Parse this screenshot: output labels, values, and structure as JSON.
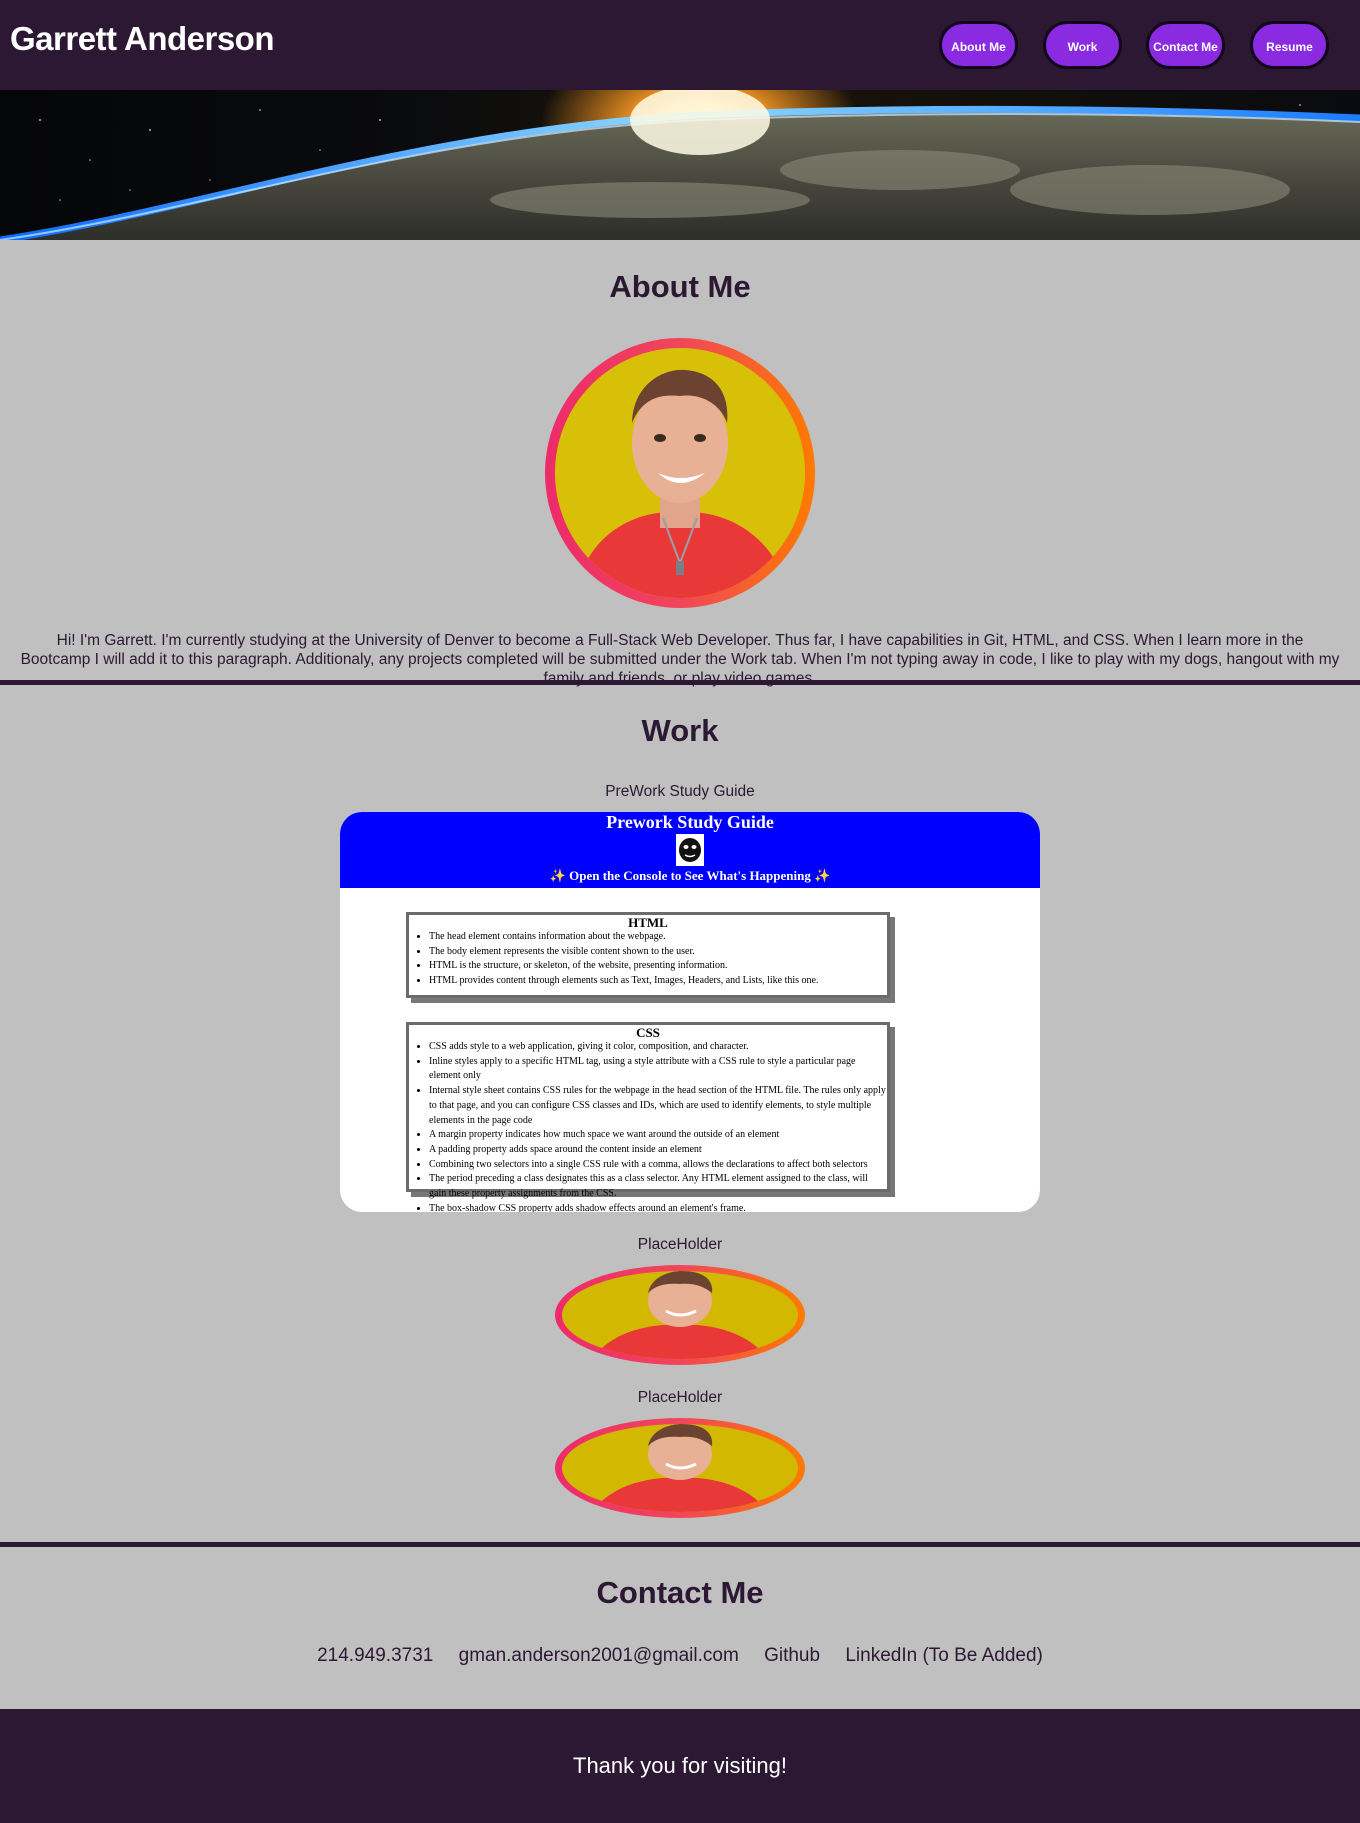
{
  "header": {
    "title": "Garrett Anderson",
    "nav": [
      {
        "label": "About Me"
      },
      {
        "label": "Work"
      },
      {
        "label": "Contact Me"
      },
      {
        "label": "Resume"
      }
    ]
  },
  "about": {
    "heading": "About Me",
    "text": "Hi! I'm Garrett. I'm currently studying at the University of Denver to become a Full-Stack Web Developer. Thus far, I have capabilities in Git, HTML, and CSS. When I learn more in the Bootcamp I will add it to this paragraph. Additionaly, any projects completed will be submitted under the Work tab. When I'm not typing away in code, I like to play with my dogs, hangout with my family and friends, or play video games."
  },
  "work": {
    "heading": "Work",
    "projects": [
      {
        "label": "PreWork Study Guide",
        "preview": {
          "title": "Prework Study Guide",
          "subtitle": "✨ Open the Console to See What's Happening ✨",
          "html_heading": "HTML",
          "html_items": [
            "The head element contains information about the webpage.",
            "The body element represents the visible content shown to the user.",
            "HTML is the structure, or skeleton, of the website, presenting information.",
            "HTML provides content through elements such as Text, Images, Headers, and Lists, like this one."
          ],
          "css_heading": "CSS",
          "css_items": [
            "CSS adds style to a web application, giving it color, composition, and character.",
            "Inline styles apply to a specific HTML tag, using a style attribute with a CSS rule to style a particular page element only",
            "Internal style sheet contains CSS rules for the webpage in the head section of the HTML file. The rules only apply to that page, and you can configure CSS classes and IDs, which are used to identify elements, to style multiple elements in the page code",
            "A margin property indicates how much space we want around the outside of an element",
            "A padding property adds space around the content inside an element",
            "Combining two selectors into a single CSS rule with a comma, allows the declarations to affect both selectors",
            "The period preceding a class designates this as a class selector. Any HTML element assigned to the class, will gain these property assignments from the CSS.",
            "The box-shadow CSS property adds shadow effects around an element's frame."
          ]
        }
      },
      {
        "label": "PlaceHolder"
      },
      {
        "label": "PlaceHolder"
      }
    ]
  },
  "contact": {
    "heading": "Contact Me",
    "phone": "214.949.3731",
    "email": "gman.anderson2001@gmail.com",
    "github": "Github",
    "linkedin": "LinkedIn (To Be Added)"
  },
  "footer": {
    "text": "Thank you for visiting!"
  },
  "colors": {
    "header_bg": "#2c1833",
    "page_bg": "#c0c0c0",
    "nav_button": "#8a2be2",
    "accent_gradient_start": "#ee2a6b",
    "accent_gradient_end": "#ff7a00"
  }
}
